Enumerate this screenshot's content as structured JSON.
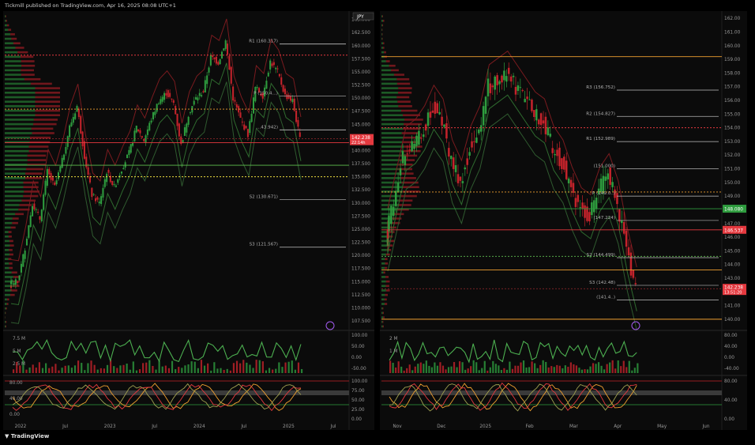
{
  "header": {
    "text": "Tickmill published on TradingView.com, Apr 16, 2025 08:08 UTC+1"
  },
  "footer": {
    "logo_text": "TradingView"
  },
  "colors": {
    "bg": "#0b0b0b",
    "up": "#2e9c3e",
    "down": "#c4232b",
    "grid": "#1c1c1c",
    "level_red": "#e5393f",
    "level_orange": "#f0a030",
    "level_green": "#5fbf4f",
    "purple": "#a35cf0",
    "text": "#b0b0b0"
  },
  "chart_data": [
    {
      "type": "line",
      "panel": "left",
      "currency_badge": "JPY",
      "x_tick_labels": [
        "2022",
        "Jul",
        "2023",
        "Jul",
        "2024",
        "Jul",
        "2025",
        "Jul"
      ],
      "y_tick_labels": [
        "107.500",
        "110.000",
        "112.500",
        "115.000",
        "117.500",
        "120.000",
        "122.500",
        "125.000",
        "127.500",
        "130.000",
        "132.500",
        "135.000",
        "137.500",
        "140.000",
        "142.500",
        "145.000",
        "147.500",
        "150.000",
        "152.500",
        "155.000",
        "157.500",
        "160.000",
        "162.500",
        "165.000"
      ],
      "ylim": [
        106,
        166
      ],
      "last_price": "142.238",
      "last_price_sub": "22:14h",
      "x": [
        "2022-01",
        "2022-02",
        "2022-03",
        "2022-04",
        "2022-05",
        "2022-06",
        "2022-07",
        "2022-08",
        "2022-09",
        "2022-10",
        "2022-11",
        "2022-12",
        "2023-01",
        "2023-02",
        "2023-03",
        "2023-04",
        "2023-05",
        "2023-06",
        "2023-07",
        "2023-08",
        "2023-09",
        "2023-10",
        "2023-11",
        "2023-12",
        "2024-01",
        "2024-02",
        "2024-03",
        "2024-04",
        "2024-05",
        "2024-06",
        "2024-07",
        "2024-08",
        "2024-09",
        "2024-10",
        "2024-11",
        "2024-12",
        "2025-01",
        "2025-02",
        "2025-03",
        "2025-04"
      ],
      "series": [
        {
          "values": [
            115.0,
            114.8,
            121.5,
            130.0,
            127.0,
            136.0,
            133.0,
            138.0,
            144.5,
            148.5,
            139.0,
            131.5,
            130.0,
            136.0,
            133.0,
            136.5,
            139.5,
            144.5,
            142.0,
            146.0,
            149.5,
            151.0,
            149.0,
            141.0,
            147.0,
            150.0,
            151.3,
            157.8,
            156.8,
            160.9,
            150.0,
            146.0,
            143.0,
            152.0,
            150.5,
            157.0,
            155.0,
            150.5,
            149.5,
            142.2
          ]
        }
      ],
      "levels": [
        {
          "label": "R1 (160.317)",
          "value": 160.317
        },
        {
          "label": "P (150.4...)",
          "value": 150.4
        },
        {
          "label": "...43.942)",
          "value": 143.942
        },
        {
          "label": "S2 (130.671)",
          "value": 130.671
        },
        {
          "label": "S3 (121.567)",
          "value": 121.567
        }
      ],
      "volume": {
        "ylim_labels": [
          "7.5 M",
          "5 M",
          "2.5 M"
        ],
        "osc_labels": [
          "100.00",
          "50.00",
          "0.00",
          "-50.00"
        ]
      },
      "stoch": {
        "left_labels": [
          "80.00",
          "40.00",
          "0.00"
        ],
        "right_labels": [
          "100.00",
          "75.00",
          "50.00",
          "25.00",
          "0.00"
        ]
      }
    },
    {
      "type": "line",
      "panel": "right",
      "x_tick_labels": [
        "Nov",
        "Dec",
        "2025",
        "Feb",
        "Mar",
        "Apr",
        "May",
        "Jun"
      ],
      "y_tick_labels": [
        "140.00",
        "141.00",
        "142.00",
        "143.00",
        "144.00",
        "145.00",
        "146.00",
        "147.00",
        "148.00",
        "149.00",
        "150.00",
        "151.00",
        "152.00",
        "153.00",
        "154.00",
        "155.00",
        "156.00",
        "157.00",
        "158.00",
        "159.00",
        "160.00",
        "161.00",
        "162.00"
      ],
      "ylim": [
        139.3,
        162.3
      ],
      "last_price": "142.238",
      "last_price_sub": "13:51:20",
      "x": [
        "2024-10-07",
        "2024-10-14",
        "2024-10-21",
        "2024-10-28",
        "2024-11-04",
        "2024-11-11",
        "2024-11-18",
        "2024-11-25",
        "2024-12-02",
        "2024-12-09",
        "2024-12-16",
        "2024-12-23",
        "2024-12-30",
        "2025-01-06",
        "2025-01-13",
        "2025-01-20",
        "2025-01-27",
        "2025-02-03",
        "2025-02-10",
        "2025-02-17",
        "2025-02-24",
        "2025-03-03",
        "2025-03-10",
        "2025-03-17",
        "2025-03-24",
        "2025-03-31",
        "2025-04-07",
        "2025-04-14"
      ],
      "series": [
        {
          "values": [
            146.5,
            149.5,
            152.5,
            153.0,
            154.0,
            155.5,
            154.5,
            151.5,
            150.0,
            152.5,
            154.0,
            157.0,
            157.5,
            158.0,
            157.0,
            156.0,
            155.0,
            154.5,
            152.5,
            151.5,
            149.5,
            148.0,
            147.5,
            149.5,
            150.5,
            148.5,
            145.0,
            142.2
          ]
        }
      ],
      "levels": [
        {
          "label": "R3 (156.752)",
          "value": 156.752
        },
        {
          "label": "R2 (154.827)",
          "value": 154.827
        },
        {
          "label": "R1 (152.989)",
          "value": 152.989
        },
        {
          "label": "(151.000)",
          "value": 151.0
        },
        {
          "label": "P (149.0..)",
          "value": 149.0
        },
        {
          "label": "(147.224)",
          "value": 147.224
        },
        {
          "label": "S2 (144.499)",
          "value": 144.499
        },
        {
          "label": "S3 (142.48)",
          "value": 142.48
        },
        {
          "label": "(141.4..)",
          "value": 141.4
        }
      ],
      "level_badges": [
        {
          "label": "148.080",
          "value": 148.08,
          "color": "#2e9c3e"
        },
        {
          "label": "146.537",
          "value": 146.537,
          "color": "#e5393f"
        }
      ],
      "volume": {
        "ylim_labels": [
          "2 M",
          "1 M"
        ],
        "osc_labels": [
          "80.00",
          "40.00",
          "0.00",
          "-40.00"
        ]
      },
      "stoch": {
        "right_labels": [
          "80.00",
          "40.00",
          "0.00"
        ]
      }
    }
  ]
}
